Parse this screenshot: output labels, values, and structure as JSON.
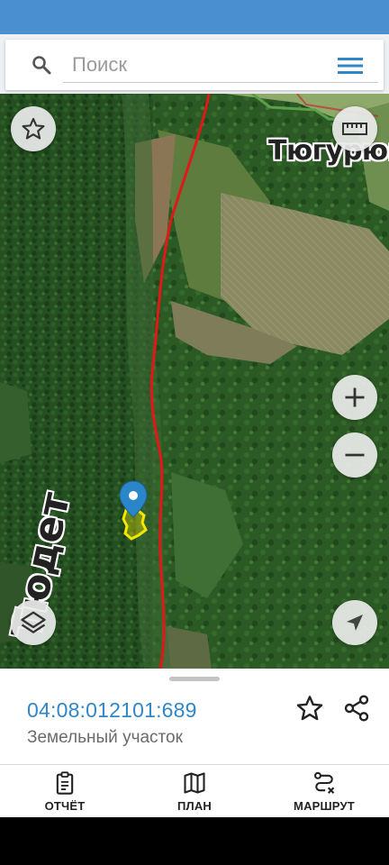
{
  "search": {
    "placeholder": "Поиск"
  },
  "map": {
    "labels": {
      "town": "Тюгурюк",
      "river": "Тюдет"
    },
    "icons": {
      "favorite": "star-outline-icon",
      "ruler": "ruler-icon",
      "zoom_in": "plus-icon",
      "zoom_out": "minus-icon",
      "layers": "layers-icon",
      "locate": "navigation-arrow-icon",
      "marker": "map-pin-icon"
    },
    "colors": {
      "boundary_line": "#e01818",
      "parcel_highlight": "#f5e600",
      "marker": "#2a86c8"
    }
  },
  "sheet": {
    "cadastral_number": "04:08:012101:689",
    "object_type": "Земельный участок"
  },
  "bottom_nav": [
    {
      "label": "ОТЧЁТ",
      "icon": "clipboard-icon"
    },
    {
      "label": "ПЛАН",
      "icon": "map-icon"
    },
    {
      "label": "МАРШРУТ",
      "icon": "route-icon"
    }
  ],
  "colors": {
    "accent": "#4a8fcf",
    "link": "#2f86c8"
  }
}
